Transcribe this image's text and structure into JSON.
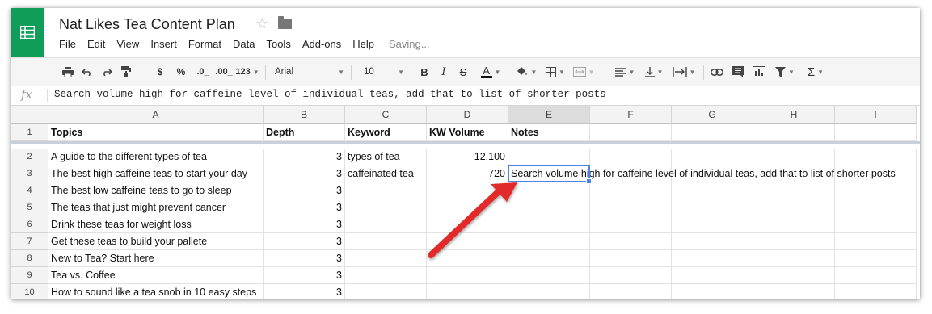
{
  "app": {
    "title": "Nat Likes Tea Content Plan",
    "status": "Saving...",
    "menu": [
      "File",
      "Edit",
      "View",
      "Insert",
      "Format",
      "Data",
      "Tools",
      "Add-ons",
      "Help"
    ]
  },
  "toolbar": {
    "currency": "$",
    "percent": "%",
    "dec_decrease": ".0_",
    "dec_increase": ".00_",
    "more_formats": "123",
    "font": "Arial",
    "font_size": "10",
    "bold": "B",
    "italic": "I",
    "strike": "S",
    "text_color": "A",
    "functions": "Σ"
  },
  "formula_bar": {
    "fx": "fx",
    "value": "Search volume high for caffeine level of individual teas, add that to list of shorter posts"
  },
  "sheet": {
    "columns": [
      "A",
      "B",
      "C",
      "D",
      "E",
      "F",
      "G",
      "H",
      "I"
    ],
    "selected_column": "E",
    "rows": [
      {
        "num": "1",
        "a": "Topics",
        "b": "Depth",
        "c": "Keyword",
        "d": "KW Volume",
        "e": "Notes"
      },
      {
        "num": "2",
        "a": "A guide to the different types of tea",
        "b": "3",
        "c": "types of tea",
        "d": "12,100",
        "e": ""
      },
      {
        "num": "3",
        "a": "The best high caffeine teas to start your day",
        "b": "3",
        "c": "caffeinated tea",
        "d": "720",
        "e": "Search volume high for caffeine level of individual teas, add that to list of shorter posts"
      },
      {
        "num": "4",
        "a": "The best low caffeine teas to go to sleep",
        "b": "3",
        "c": "",
        "d": "",
        "e": ""
      },
      {
        "num": "5",
        "a": "The teas that just might prevent cancer",
        "b": "3",
        "c": "",
        "d": "",
        "e": ""
      },
      {
        "num": "6",
        "a": "Drink these teas for weight loss",
        "b": "3",
        "c": "",
        "d": "",
        "e": ""
      },
      {
        "num": "7",
        "a": "Get these teas to build your pallete",
        "b": "3",
        "c": "",
        "d": "",
        "e": ""
      },
      {
        "num": "8",
        "a": "New to Tea? Start here",
        "b": "3",
        "c": "",
        "d": "",
        "e": ""
      },
      {
        "num": "9",
        "a": "Tea vs. Coffee",
        "b": "3",
        "c": "",
        "d": "",
        "e": ""
      },
      {
        "num": "10",
        "a": "How to sound like a tea snob in 10 easy steps",
        "b": "3",
        "c": "",
        "d": "",
        "e": ""
      }
    ]
  },
  "colors": {
    "brand_green": "#0f9d58",
    "selection_blue": "#4a86e8",
    "arrow_red": "#e32b2b"
  }
}
